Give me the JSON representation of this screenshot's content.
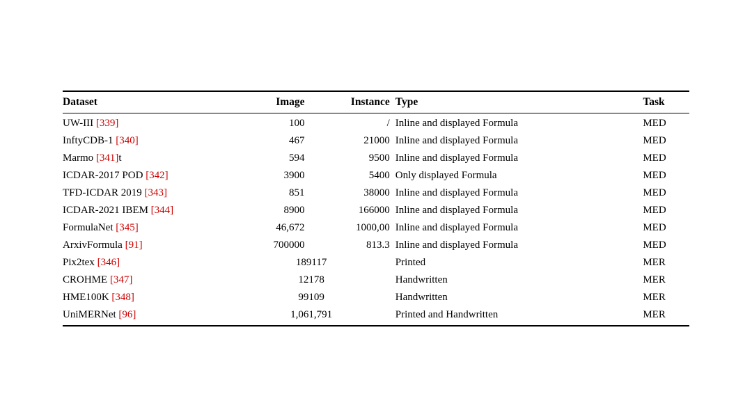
{
  "table": {
    "headers": [
      {
        "label": "Dataset",
        "class": "col-dataset"
      },
      {
        "label": "Image",
        "class": "col-image"
      },
      {
        "label": "Instance",
        "class": "col-instance"
      },
      {
        "label": "Type",
        "class": "col-type"
      },
      {
        "label": "Task",
        "class": "col-task"
      }
    ],
    "rows": [
      {
        "dataset": "UW-III ",
        "ref": "[339]",
        "image": "100",
        "instance": "/",
        "type": "Inline and displayed Formula",
        "task": "MED"
      },
      {
        "dataset": "InftyCDB-1 ",
        "ref": "[340]",
        "image": "467",
        "instance": "21000",
        "type": "Inline and displayed Formula",
        "task": "MED"
      },
      {
        "dataset": "Marmo ",
        "ref": "[341]",
        "dataset_suffix": "t",
        "image": "594",
        "instance": "9500",
        "type": "Inline and displayed Formula",
        "task": "MED"
      },
      {
        "dataset": "ICDAR-2017 POD ",
        "ref": "[342]",
        "image": "3900",
        "instance": "5400",
        "type": "Only displayed Formula",
        "task": "MED"
      },
      {
        "dataset": "TFD-ICDAR 2019  ",
        "ref": "[343]",
        "image": "851",
        "instance": "38000",
        "type": "Inline and displayed Formula",
        "task": "MED"
      },
      {
        "dataset": "ICDAR-2021 IBEM ",
        "ref": "[344]",
        "image": "8900",
        "instance": "166000",
        "type": "Inline and displayed Formula",
        "task": "MED"
      },
      {
        "dataset": "FormulaNet ",
        "ref": "[345]",
        "image": "46,672",
        "instance": "1000,00",
        "type": "Inline and displayed Formula",
        "task": "MED"
      },
      {
        "dataset": "ArxivFormula ",
        "ref": "[91]",
        "image": "700000",
        "instance": "813.3",
        "type": "Inline and displayed Formula",
        "task": "MED"
      },
      {
        "dataset": "Pix2tex ",
        "ref": "[346]",
        "image": "",
        "instance": "189117",
        "type": "Printed",
        "task": "MER",
        "merged": true
      },
      {
        "dataset": "CROHME ",
        "ref": "[347]",
        "image": "",
        "instance": "12178",
        "type": "Handwritten",
        "task": "MER",
        "merged": true
      },
      {
        "dataset": "HME100K ",
        "ref": "[348]",
        "image": "",
        "instance": "99109",
        "type": "Handwritten",
        "task": "MER",
        "merged": true
      },
      {
        "dataset": "UniMERNet ",
        "ref": "[96]",
        "image": "",
        "instance": "1,061,791",
        "type": "Printed and Handwritten",
        "task": "MER",
        "merged": true,
        "last": true
      }
    ]
  }
}
